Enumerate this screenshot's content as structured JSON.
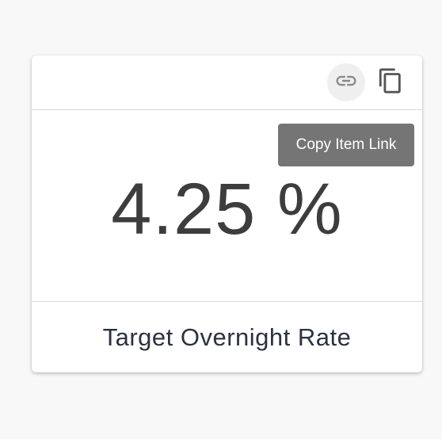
{
  "card": {
    "icons": {
      "link": "link-icon",
      "copy": "copy-icon"
    },
    "tooltip": "Copy Item Link",
    "value": "4.25 %",
    "label": "Target Overnight Rate"
  },
  "colors": {
    "background": "#f8f8f8",
    "card": "#ffffff",
    "tooltip_bg": "#757575",
    "value_text": "#3d3d3d",
    "label_text": "#2b3240"
  }
}
